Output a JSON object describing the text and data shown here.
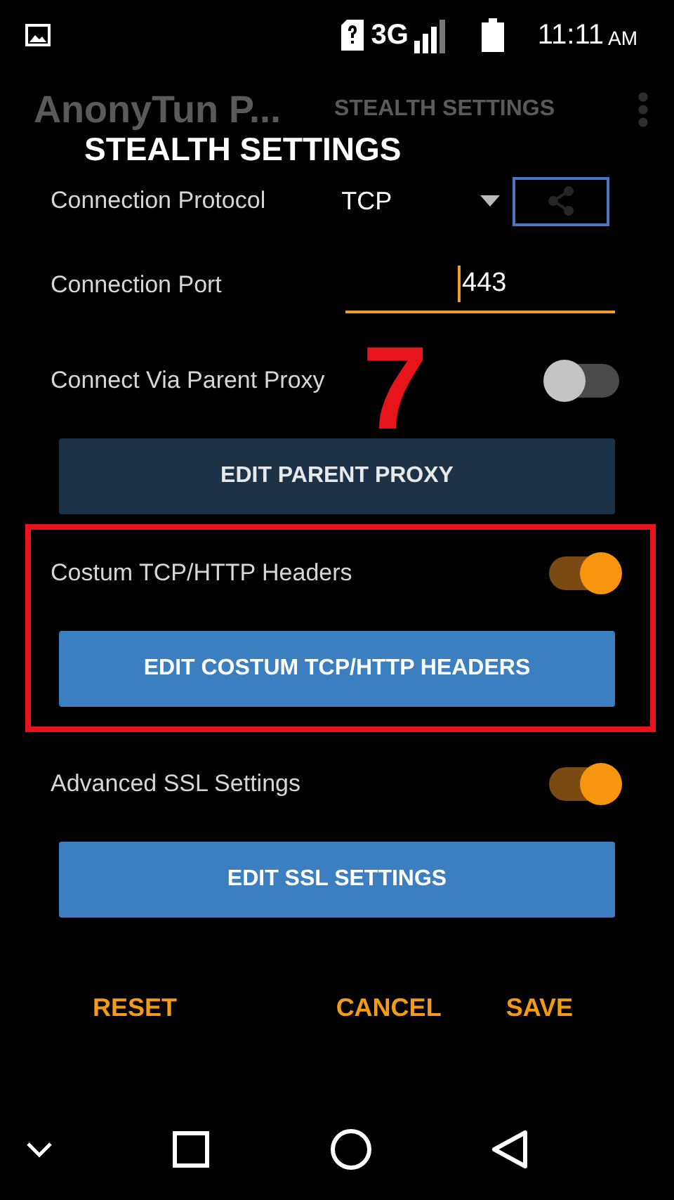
{
  "status_bar": {
    "network": "3G",
    "time": "11:11",
    "meridiem": "AM"
  },
  "app_bar": {
    "title": "AnonyTun P...",
    "tab": "STEALTH SETTINGS"
  },
  "dialog": {
    "title": "STEALTH SETTINGS",
    "rows": [
      {
        "kind": "dropdown",
        "label": "Connection Protocol",
        "value": "TCP",
        "highlighted": false
      },
      {
        "kind": "field",
        "label": "Connection Port",
        "value": "443",
        "highlighted": false
      },
      {
        "kind": "toggle",
        "label": "Connect Via Parent Proxy",
        "on": false,
        "annotation": "7",
        "highlighted": false
      },
      {
        "kind": "button",
        "label": "EDIT PARENT PROXY",
        "disabled": true,
        "highlighted": false
      },
      {
        "kind": "toggle",
        "label": "Costum TCP/HTTP Headers",
        "on": true,
        "highlighted": true
      },
      {
        "kind": "button",
        "label": "EDIT COSTUM TCP/HTTP HEADERS",
        "disabled": false,
        "highlighted": true
      },
      {
        "kind": "toggle",
        "label": "Advanced SSL Settings",
        "on": true,
        "highlighted": false
      },
      {
        "kind": "button",
        "label": "EDIT SSL SETTINGS",
        "disabled": false,
        "highlighted": false
      }
    ],
    "actions": [
      "RESET",
      "CANCEL",
      "SAVE"
    ]
  }
}
